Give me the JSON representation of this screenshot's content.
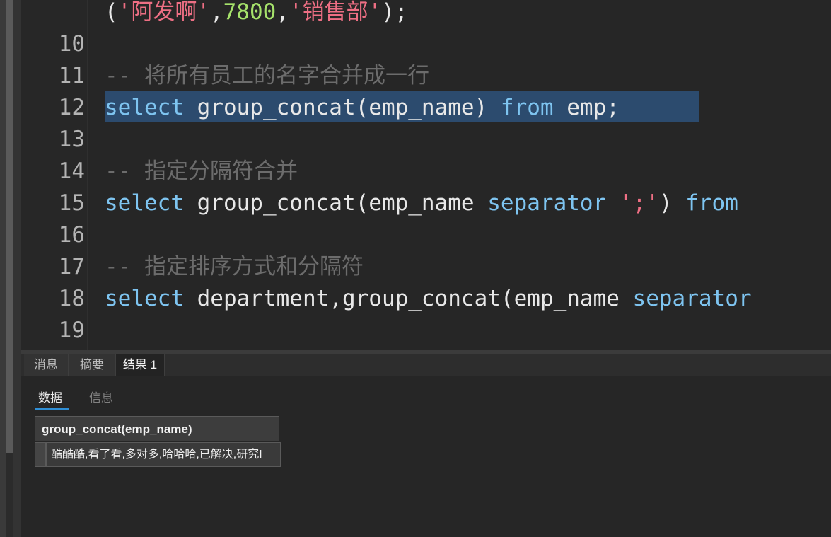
{
  "editor": {
    "lines": [
      {
        "num": "",
        "y": 0
      },
      {
        "num": "10"
      },
      {
        "num": "11"
      },
      {
        "num": "12"
      },
      {
        "num": "13"
      },
      {
        "num": "14"
      },
      {
        "num": "15"
      },
      {
        "num": "16"
      },
      {
        "num": "17"
      },
      {
        "num": "18"
      },
      {
        "num": "19"
      }
    ],
    "line9": {
      "open": "(",
      "s1": "'阿发啊'",
      "comma1": ",",
      "n": "7800",
      "comma2": ",",
      "s2": "'销售部'",
      "close": ");"
    },
    "line11": "-- 将所有员工的名字合并成一行",
    "line12": {
      "kw1": "select",
      "mid": " group_concat(emp_name) ",
      "kw2": "from",
      "end": " emp;"
    },
    "line14": "-- 指定分隔符合并",
    "line15": {
      "kw1": "select",
      "mid": " group_concat(emp_name ",
      "kw2": "separator",
      "sp": " ",
      "str": "';'",
      "mid2": ") ",
      "kw3": "from"
    },
    "line17": "-- 指定排序方式和分隔符",
    "line18": {
      "kw1": "select",
      "mid": " department,group_concat(emp_name ",
      "kw2": "separator"
    }
  },
  "results": {
    "tabs": [
      "消息",
      "摘要",
      "结果 1"
    ],
    "active_tab": "结果 1",
    "subtabs": {
      "data": "数据",
      "info": "信息"
    },
    "grid": {
      "columns": [
        "group_concat(emp_name)"
      ],
      "rows": [
        [
          "酷酷酷,看了看,多对多,哈哈哈,已解决,研究I"
        ]
      ]
    }
  }
}
